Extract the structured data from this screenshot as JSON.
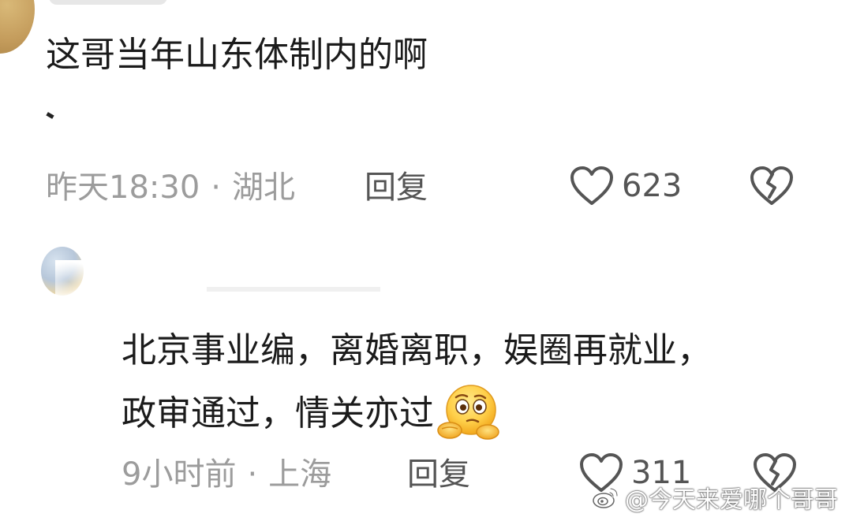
{
  "comment1": {
    "text": "这哥当年山东体制内的啊",
    "time": "昨天18:30",
    "location": "湖北",
    "separator": "·",
    "reply_label": "回复",
    "likes": "623"
  },
  "comment2": {
    "line1": "北京事业编，离婚离职，娱圈再就业，",
    "line2": "政审通过，情关亦过",
    "emoji": "thinking-face-with-hand-emoji",
    "time": "9小时前",
    "location": "上海",
    "separator": "·",
    "reply_label": "回复",
    "likes": "311"
  },
  "watermark": {
    "text": "@今天来爱哪个哥哥",
    "icon": "weibo-logo-icon"
  },
  "colors": {
    "meta_gray": "#9c9c9c",
    "text_dark": "#1b1b1b",
    "icon_gray": "#555555"
  }
}
